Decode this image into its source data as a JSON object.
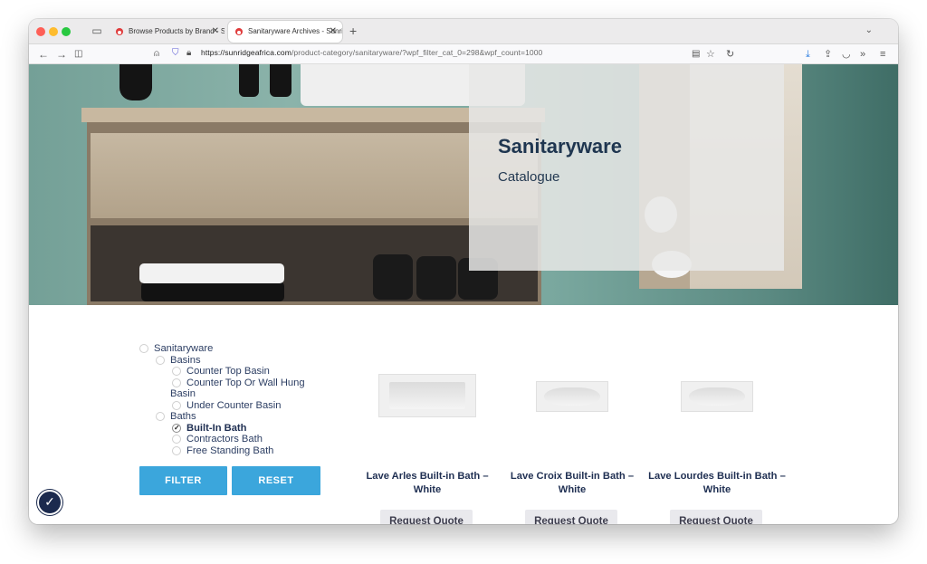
{
  "browser": {
    "tabs": [
      {
        "title": "Browse Products by Brand - Su",
        "active": false
      },
      {
        "title": "Sanitaryware Archives - Sunrid",
        "active": true
      }
    ],
    "url_domain": "https://sunridgeafrica.com",
    "url_path": "/product-category/sanitaryware/?wpf_filter_cat_0=298&wpf_count=1000"
  },
  "hero": {
    "title": "Sanitaryware",
    "subtitle": "Catalogue"
  },
  "filter": {
    "items": [
      {
        "label": "Sanitaryware",
        "checked": false
      },
      {
        "label": "Basins",
        "checked": false
      },
      {
        "label": "Counter Top Basin",
        "checked": false
      },
      {
        "label": "Counter Top Or Wall Hung",
        "label_cont": "Basin",
        "checked": false
      },
      {
        "label": "Under Counter Basin",
        "checked": false
      },
      {
        "label": "Baths",
        "checked": false
      },
      {
        "label": "Built-In Bath",
        "checked": true
      },
      {
        "label": "Contractors Bath",
        "checked": false
      },
      {
        "label": "Free Standing Bath",
        "checked": false
      }
    ],
    "filter_button": "FILTER",
    "reset_button": "RESET"
  },
  "products": [
    {
      "name": "Lave Arles Built-in Bath – White",
      "cta": "Request Quote"
    },
    {
      "name": "Lave Croix Built-in Bath – White",
      "cta": "Request Quote"
    },
    {
      "name": "Lave Lourdes Built-in Bath – White",
      "cta": "Request Quote"
    }
  ],
  "colors": {
    "accent": "#3ba6dc",
    "heading": "#1f3650",
    "text": "#2c3e63"
  }
}
